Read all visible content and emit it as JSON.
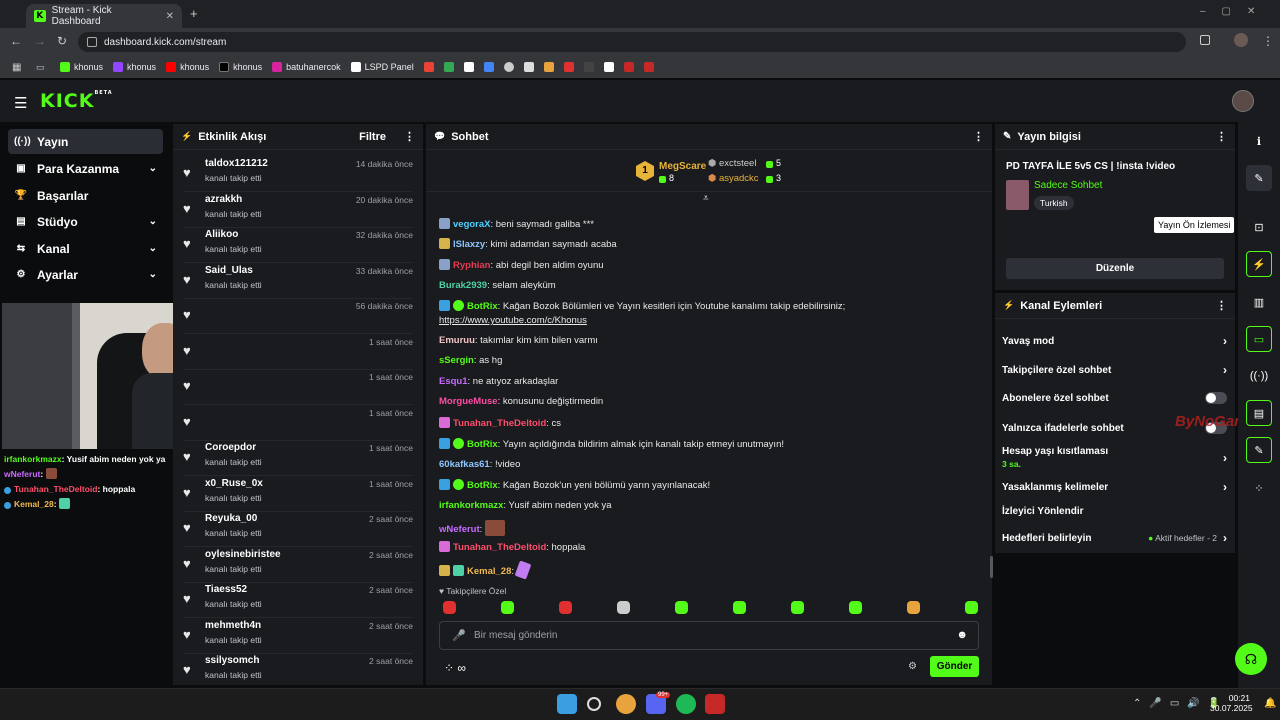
{
  "browser": {
    "tab_title": "Stream - Kick Dashboard",
    "url": "dashboard.kick.com/stream",
    "bookmarks": [
      "khonus",
      "khonus",
      "khonus",
      "khonus",
      "batuhanercok",
      "LSPD Panel"
    ]
  },
  "brand": {
    "logo": "KICK",
    "beta": "BETA",
    "accent": "#53fc18"
  },
  "nav": [
    {
      "label": "Yayın",
      "icon": "broadcast-icon",
      "active": true
    },
    {
      "label": "Para Kazanma",
      "icon": "money-icon",
      "chevron": true
    },
    {
      "label": "Başarılar",
      "icon": "trophy-icon"
    },
    {
      "label": "Stüdyo",
      "icon": "studio-icon",
      "chevron": true
    },
    {
      "label": "Kanal",
      "icon": "channel-icon",
      "chevron": true
    },
    {
      "label": "Ayarlar",
      "icon": "gear-icon",
      "chevron": true
    }
  ],
  "overlay_chat": [
    {
      "user": "irfankorkmazx",
      "text": ": Yusif abim neden yok ya"
    },
    {
      "user": "wNeferut",
      "text": ":"
    },
    {
      "user": "Tunahan_TheDeltoid",
      "text": ": hoppala"
    },
    {
      "user": "Kemal_28",
      "text": ":"
    }
  ],
  "activity": {
    "title": "Etkinlik Akışı",
    "filter": "Filtre",
    "items": [
      {
        "name": "taldox121212",
        "action": "kanalı takip etti",
        "time": "14 dakika önce"
      },
      {
        "name": "azrakkh",
        "action": "kanalı takip etti",
        "time": "20 dakika önce"
      },
      {
        "name": "Aliikoo",
        "action": "kanalı takip etti",
        "time": "32 dakika önce"
      },
      {
        "name": "Said_Ulas",
        "action": "kanalı takip etti",
        "time": "33 dakika önce"
      },
      {
        "name": "",
        "action": "",
        "time": "56 dakika önce"
      },
      {
        "name": "",
        "action": "",
        "time": "1 saat önce"
      },
      {
        "name": "",
        "action": "",
        "time": "1 saat önce"
      },
      {
        "name": "",
        "action": "",
        "time": "1 saat önce"
      },
      {
        "name": "Coroepdor",
        "action": "kanalı takip etti",
        "time": "1 saat önce"
      },
      {
        "name": "x0_Ruse_0x",
        "action": "kanalı takip etti",
        "time": "1 saat önce"
      },
      {
        "name": "Reyuka_00",
        "action": "kanalı takip etti",
        "time": "2 saat önce"
      },
      {
        "name": "oylesinebiristee",
        "action": "kanalı takip etti",
        "time": "2 saat önce"
      },
      {
        "name": "Tiaess52",
        "action": "kanalı takip etti",
        "time": "2 saat önce"
      },
      {
        "name": "mehmeth4n",
        "action": "kanalı takip etti",
        "time": "2 saat önce"
      },
      {
        "name": "ssilysomch",
        "action": "kanalı takip etti",
        "time": "2 saat önce"
      }
    ]
  },
  "chat": {
    "title": "Sohbet",
    "leaders": {
      "first": {
        "rank": "1",
        "name": "MegScare",
        "count": "8"
      },
      "second": {
        "name": "exctsteel",
        "count": "5"
      },
      "third": {
        "name": "asyadckc",
        "count": "3"
      }
    },
    "messages": [
      {
        "user": "vegoraX",
        "color": "#4fd1ff",
        "badge": "#8aa2c7",
        "text": ": beni saymadı galiba ***"
      },
      {
        "user": "lSlaxzy",
        "color": "#8ec5ff",
        "badge": "#d6b34a",
        "text": ": kimi adamdan saymadı acaba"
      },
      {
        "user": "Ryphian",
        "color": "#e83b52",
        "badge": "#8aa2c7",
        "text": ": abi degil ben aldim oyunu"
      },
      {
        "user": "Burak2939",
        "color": "#4fd1a5",
        "badge": "",
        "text": ": selam aleyküm"
      },
      {
        "user": "BotRix",
        "color": "#53fc18",
        "badge": "#3aa0e0",
        "verified": true,
        "text": ": Kağan Bozok Bölümleri ve Yayın kesitleri için Youtube kanalımı takip edebilirsiniz;",
        "link": "https://www.youtube.com/c/Khonus"
      },
      {
        "user": "Emuruu",
        "color": "#f2c4c4",
        "badge": "",
        "text": ": takımlar kim kim bilen varmı"
      },
      {
        "user": "sSergin",
        "color": "#53fc18",
        "badge": "",
        "text": ": as hg"
      },
      {
        "user": "Esqu1",
        "color": "#c76bff",
        "badge": "",
        "text": ": ne atıyoz arkadaşlar"
      },
      {
        "user": "MorgueMuse",
        "color": "#ff4da6",
        "badge": "",
        "text": ": konusunu değiştirmedin"
      },
      {
        "user": "Tunahan_TheDeltoid",
        "color": "#ff4d6a",
        "badge": "#d96bd6",
        "text": ": cs"
      },
      {
        "user": "BotRix",
        "color": "#53fc18",
        "badge": "#3aa0e0",
        "verified": true,
        "text": ": Yayın açıldığında bildirim almak için kanalı takip etmeyi unutmayın!"
      },
      {
        "user": "60kafkas61",
        "color": "#8ec5ff",
        "badge": "",
        "text": ": !video"
      },
      {
        "user": "BotRix",
        "color": "#53fc18",
        "badge": "#3aa0e0",
        "verified": true,
        "text": ": Kağan Bozok'un yeni bölümü yarın yayınlanacak!"
      },
      {
        "user": "irfankorkmazx",
        "color": "#53fc18",
        "badge": "",
        "text": ": Yusif abim neden yok ya"
      },
      {
        "user": "wNeferut",
        "color": "#c76bff",
        "badge": "",
        "text": ":",
        "emote": true
      },
      {
        "user": "Tunahan_TheDeltoid",
        "color": "#ff4d6a",
        "badge": "#d96bd6",
        "text": ": hoppala"
      },
      {
        "user": "Kemal_28",
        "color": "#f2b94f",
        "badge": "#d6b34a",
        "badge2": "#4fd1a5",
        "text": ":",
        "emote2": true
      }
    ],
    "follower_label": "Takipçilere Özel",
    "input_placeholder": "Bir mesaj gönderin",
    "send_label": "Gönder"
  },
  "stream_info": {
    "title": "Yayın bilgisi",
    "stream_title": "PD TAYFA İLE 5v5 CS | !insta !video",
    "category": "Sadece Sohbet",
    "tag": "Turkish",
    "edit_label": "Düzenle",
    "tooltip": "Yayın Ön İzlemesi"
  },
  "channel_actions": {
    "title": "Kanal Eylemleri",
    "items": [
      {
        "label": "Yavaş mod",
        "chevron": true
      },
      {
        "label": "Takipçilere özel sohbet",
        "chevron": true
      },
      {
        "label": "Abonelere özel sohbet",
        "toggle": true
      },
      {
        "label": "Yalnızca ifadelerle sohbet",
        "toggle": true
      },
      {
        "label": "Hesap yaşı kısıtlaması",
        "sub": "3 sa.",
        "chevron": true
      },
      {
        "label": "Yasaklanmış kelimeler",
        "chevron": true
      },
      {
        "label": "İzleyici Yönlendir"
      },
      {
        "label": "Hedefleri belirleyin",
        "status": "Aktif hedefler - 2",
        "chevron": true
      }
    ]
  },
  "watermark": "ByNoGame",
  "taskbar": {
    "time": "00:21",
    "date": "30.07.2025",
    "badge": "99+"
  }
}
